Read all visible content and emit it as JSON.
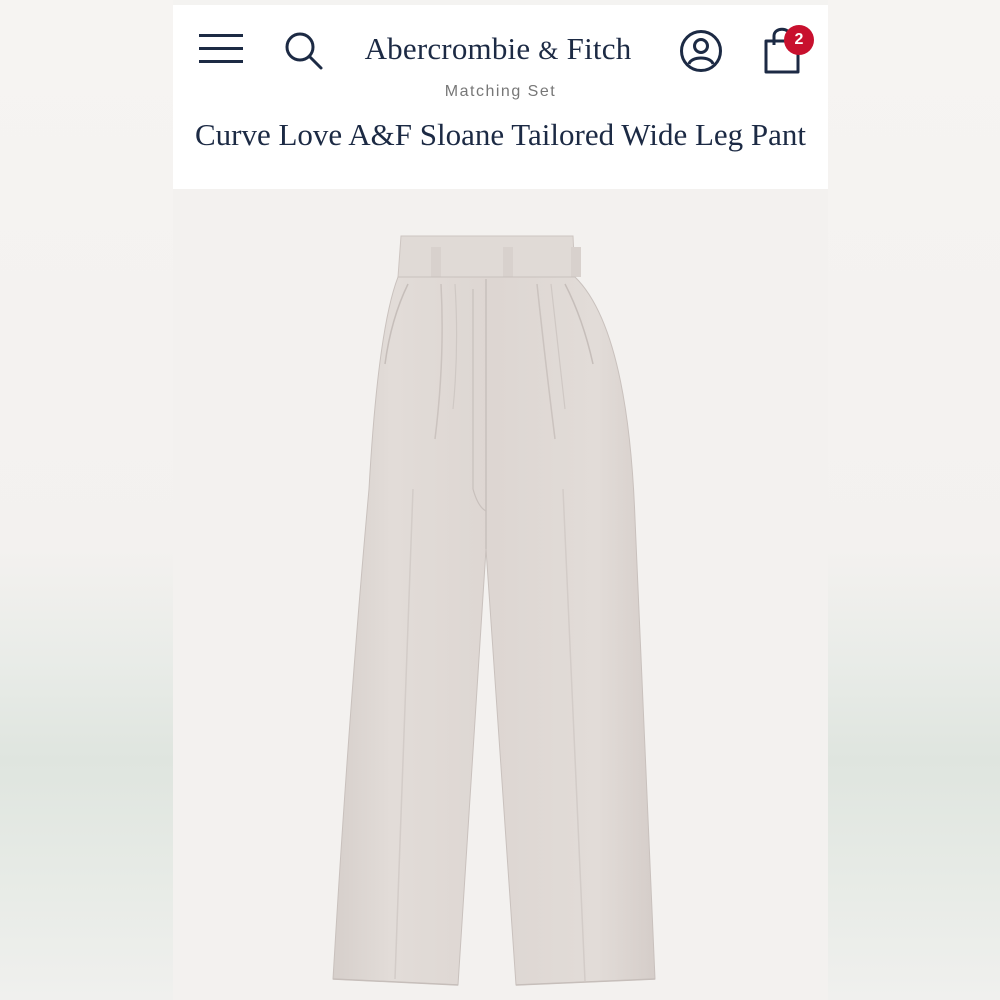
{
  "header": {
    "brand_name": "Abercrombie",
    "brand_amp": "&",
    "brand_name_2": "Fitch",
    "bag_count": "2",
    "accent_color": "#1c2a44",
    "badge_color": "#c8102e",
    "icons": [
      "menu-icon",
      "search-icon",
      "account-icon",
      "shopping-bag-icon"
    ]
  },
  "product": {
    "eyebrow": "Matching Set",
    "title": "Curve Love A&F Sloane Tailored Wide Leg Pant",
    "image": "cream-tailored-wide-leg-pant",
    "color": "#ddd6d2"
  }
}
